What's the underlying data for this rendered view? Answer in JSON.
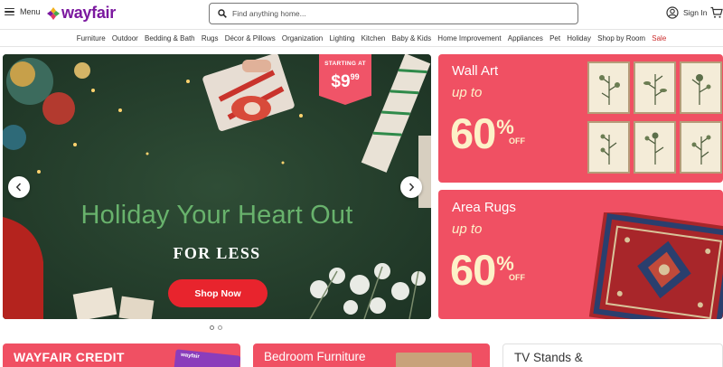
{
  "header": {
    "menu_label": "Menu",
    "logo_text": "wayfair",
    "search_placeholder": "Find anything home...",
    "signin_label": "Sign In"
  },
  "nav": {
    "categories": [
      "Furniture",
      "Outdoor",
      "Bedding & Bath",
      "Rugs",
      "Décor & Pillows",
      "Organization",
      "Lighting",
      "Kitchen",
      "Baby & Kids",
      "Home Improvement",
      "Appliances",
      "Pet",
      "Holiday",
      "Shop by Room"
    ],
    "sale_label": "Sale"
  },
  "hero": {
    "tag_label": "STARTING AT",
    "tag_price": "$9",
    "tag_cents": "99",
    "title": "Holiday Your Heart Out",
    "subtitle": "FOR LESS",
    "button_label": "Shop Now",
    "colors": {
      "title": "#68b26c",
      "button": "#e8242d",
      "background": "#27412e"
    }
  },
  "promos": [
    {
      "title": "Wall Art",
      "upto": "up to",
      "percent": "60",
      "percent_sign": "%",
      "off": "OFF"
    },
    {
      "title": "Area Rugs",
      "upto": "up to",
      "percent": "60",
      "percent_sign": "%",
      "off": "OFF"
    }
  ],
  "bottom_tiles": {
    "credit_label": "WAYFAIR CREDIT",
    "credit_card_text": "wayfair",
    "bedroom_label": "Bedroom Furniture",
    "tv_label": "TV Stands &"
  },
  "colors": {
    "brand": "#7b189f",
    "promo": "#f05063",
    "promo_text": "#fdf1c8",
    "sale": "#cb2b2b"
  },
  "icons": [
    "hamburger-icon",
    "search-icon",
    "account-icon",
    "cart-icon",
    "chevron-left-icon",
    "chevron-right-icon"
  ]
}
